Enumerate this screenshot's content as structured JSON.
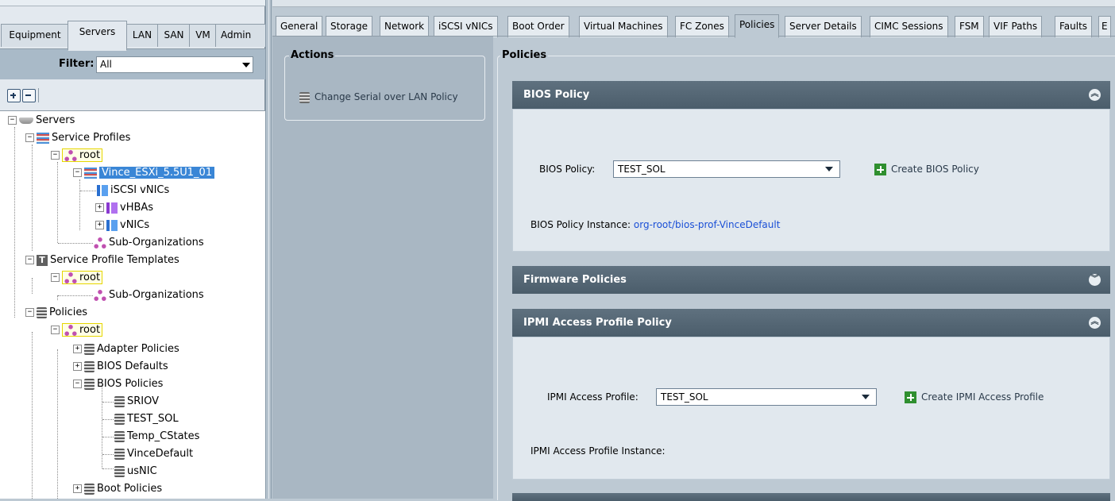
{
  "left_tabs": [
    "Equipment",
    "Servers",
    "LAN",
    "SAN",
    "VM",
    "Admin"
  ],
  "left_active_tab": "Servers",
  "filter": {
    "label": "Filter:",
    "value": "All"
  },
  "tree": {
    "servers": "Servers",
    "service_profiles": "Service Profiles",
    "root1": "root",
    "vince_profile": "Vince_ESXi_5.5U1_01",
    "iscsi_vnics": "iSCSI vNICs",
    "vhbas": "vHBAs",
    "vnics": "vNICs",
    "sub_orgs1": "Sub-Organizations",
    "service_profile_templates": "Service Profile Templates",
    "root2": "root",
    "sub_orgs2": "Sub-Organizations",
    "policies": "Policies",
    "root3": "root",
    "adapter_policies": "Adapter Policies",
    "bios_defaults": "BIOS Defaults",
    "bios_policies": "BIOS Policies",
    "sriov": "SRIOV",
    "test_sol": "TEST_SOL",
    "temp_cstates": "Temp_CStates",
    "vincedefault": "VinceDefault",
    "usnic": "usNIC",
    "boot_policies": "Boot Policies"
  },
  "right_tabs": [
    "General",
    "Storage",
    "Network",
    "iSCSI vNICs",
    "Boot Order",
    "Virtual Machines",
    "FC Zones",
    "Policies",
    "Server Details",
    "CIMC Sessions",
    "FSM",
    "VIF Paths",
    "Faults",
    "E"
  ],
  "right_active_tab": "Policies",
  "actions": {
    "title": "Actions",
    "change_sol": "Change Serial over LAN Policy"
  },
  "policies": {
    "title": "Policies",
    "bios": {
      "header": "BIOS Policy",
      "label": "BIOS Policy:",
      "value": "TEST_SOL",
      "create": "Create BIOS Policy",
      "instance_label": "BIOS Policy Instance:",
      "instance_value": "org-root/bios-prof-VinceDefault"
    },
    "firmware": {
      "header": "Firmware Policies"
    },
    "ipmi": {
      "header": "IPMI Access Profile Policy",
      "label": "IPMI Access Profile:",
      "value": "TEST_SOL",
      "create": "Create IPMI Access Profile",
      "instance_label": "IPMI Access Profile Instance:"
    }
  }
}
